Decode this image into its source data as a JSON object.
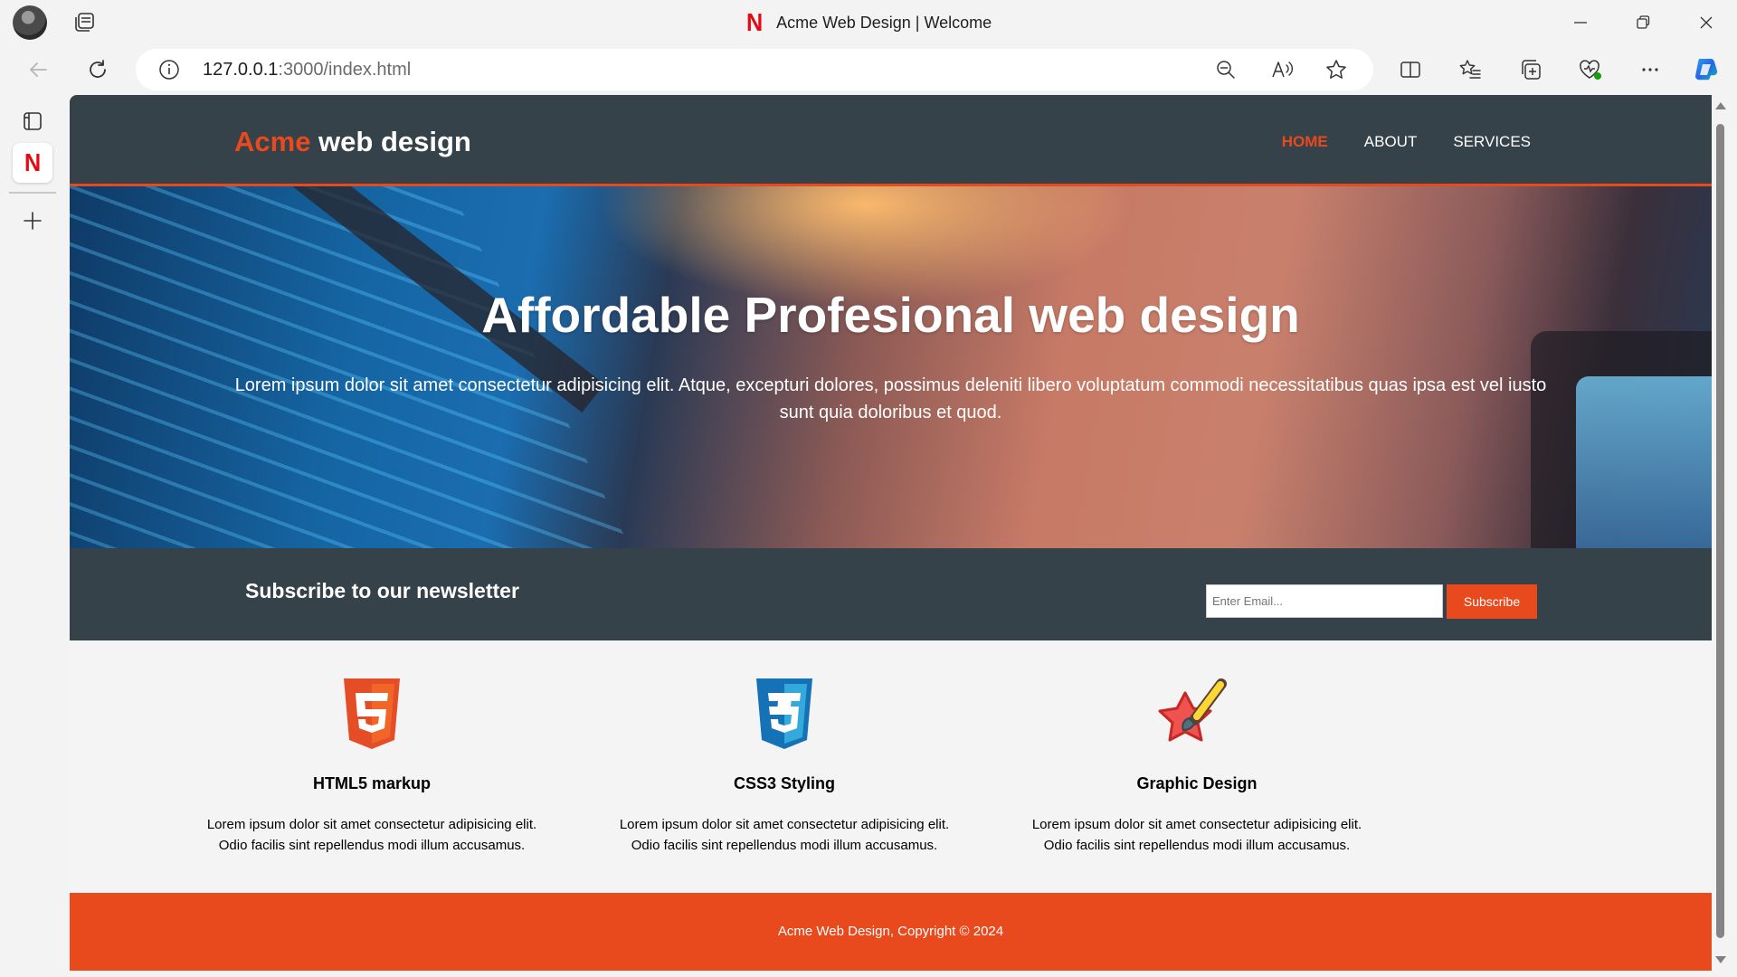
{
  "window": {
    "title": "Acme Web Design | Welcome",
    "favicon_letter": "N"
  },
  "toolbar": {
    "url_host": "127.0.0.1",
    "url_rest": ":3000/index.html"
  },
  "sidebar": {
    "favicon_letter": "N"
  },
  "site": {
    "brand_highlight": "Acme",
    "brand_rest": " web design",
    "nav": [
      {
        "label": "HOME"
      },
      {
        "label": "ABOUT"
      },
      {
        "label": "SERVICES"
      }
    ],
    "showcase": {
      "title": "Affordable Profesional web design",
      "text": "Lorem ipsum dolor sit amet consectetur adipisicing elit. Atque, excepturi dolores, possimus deleniti libero voluptatum commodi necessitatibus quas ipsa est vel iusto sunt quia doloribus et quod."
    },
    "newsletter": {
      "title": "Subscribe to our newsletter",
      "placeholder": "Enter Email...",
      "button": "Subscribe"
    },
    "boxes": [
      {
        "title": "HTML5 markup",
        "text": "Lorem ipsum dolor sit amet consectetur adipisicing elit. Odio facilis sint repellendus modi illum accusamus.",
        "icon": "html5-icon"
      },
      {
        "title": "CSS3 Styling",
        "text": "Lorem ipsum dolor sit amet consectetur adipisicing elit. Odio facilis sint repellendus modi illum accusamus.",
        "icon": "css3-icon"
      },
      {
        "title": "Graphic Design",
        "text": "Lorem ipsum dolor sit amet consectetur adipisicing elit. Odio facilis sint repellendus modi illum accusamus.",
        "icon": "graphic-design-icon"
      }
    ],
    "footer": "Acme Web Design, Copyright © 2024"
  },
  "colors": {
    "accent": "#e8491d",
    "dark": "#35424a"
  }
}
